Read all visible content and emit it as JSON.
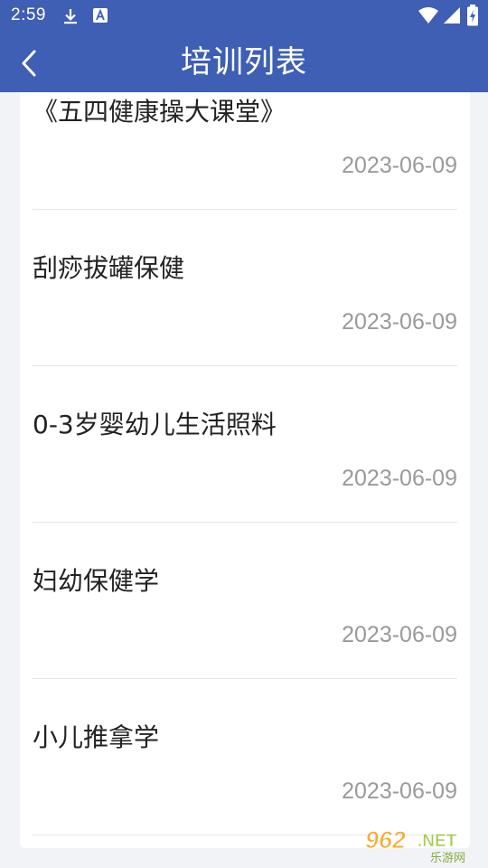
{
  "status_bar": {
    "time": "2:59",
    "icons": [
      "download-icon",
      "text-a-icon",
      "wifi-icon",
      "signal-icon",
      "battery-charging-icon"
    ]
  },
  "header": {
    "title": "培训列表",
    "back_icon": "chevron-left-icon"
  },
  "colors": {
    "header_bg": "#3f5fb5",
    "page_bg": "#f1f3f7",
    "card_bg": "#ffffff",
    "title_text": "#222222",
    "date_text": "#9a9a9a"
  },
  "training_list": [
    {
      "title": "《五四健康操大课堂》",
      "date": "2023-06-09"
    },
    {
      "title": "刮痧拔罐保健",
      "date": "2023-06-09"
    },
    {
      "title": "0-3岁婴幼儿生活照料",
      "date": "2023-06-09"
    },
    {
      "title": "妇幼保健学",
      "date": "2023-06-09"
    },
    {
      "title": "小儿推拿学",
      "date": "2023-06-09"
    }
  ],
  "watermark": {
    "number": "962",
    "suffix": ".NET",
    "cn": "乐游网"
  }
}
